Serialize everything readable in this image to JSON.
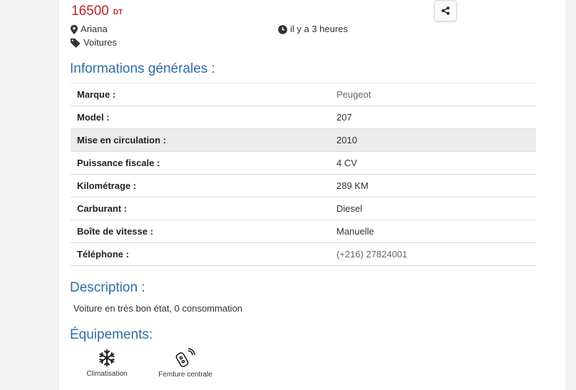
{
  "listing": {
    "price": "16500",
    "currency": "DT",
    "location": "Ariana",
    "posted": "il y a 3 heures",
    "category": "Voitures"
  },
  "sections": {
    "general_title": "Informations générales :",
    "description_title": "Description :",
    "equipment_title": "Équipements:"
  },
  "info_rows": [
    {
      "label": "Marque :",
      "value": "Peugeot"
    },
    {
      "label": "Model :",
      "value": "207"
    },
    {
      "label": "Mise en circulation :",
      "value": "2010"
    },
    {
      "label": "Puissance fiscale :",
      "value": "4 CV"
    },
    {
      "label": "Kilométrage :",
      "value": "289 KM"
    },
    {
      "label": "Carburant :",
      "value": "Diesel"
    },
    {
      "label": "Boîte de vitesse :",
      "value": "Manuelle"
    },
    {
      "label": "Téléphone :",
      "value": "(+216) 27824001"
    }
  ],
  "description": "Voiture en très bon état, 0 consommation",
  "equipments": [
    {
      "label": "Climatisation",
      "icon": "snowflake-icon"
    },
    {
      "label": "Femture centrale",
      "icon": "car-key-remote-icon"
    }
  ],
  "colors": {
    "price": "#c12128",
    "section_title": "#2e6da4",
    "highlight_row": "#ebebeb"
  }
}
